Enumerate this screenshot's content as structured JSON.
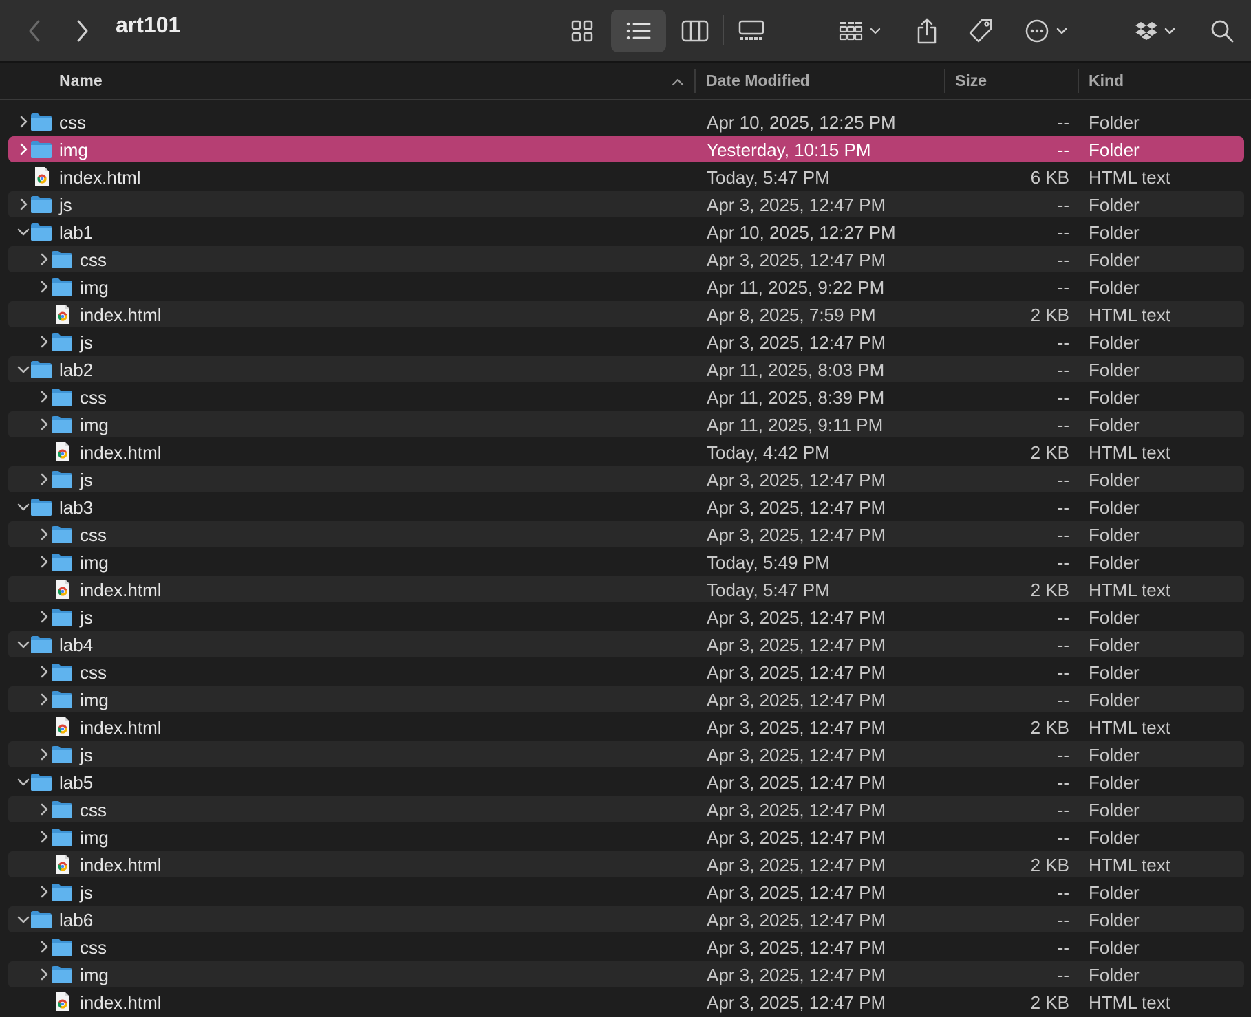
{
  "window": {
    "title": "art101"
  },
  "toolbar": {
    "back": "back-icon",
    "forward": "forward-icon",
    "views": [
      "icon-view-icon",
      "list-view-icon",
      "column-view-icon",
      "gallery-view-icon"
    ],
    "group": "group-icon",
    "share": "share-icon",
    "tag": "tag-icon",
    "more": "more-icon",
    "dropbox": "dropbox-icon",
    "search": "search-icon"
  },
  "columns": {
    "name": "Name",
    "date": "Date Modified",
    "size": "Size",
    "kind": "Kind"
  },
  "colors": {
    "selection": "#b63f73",
    "folder": "#5fb3ee"
  },
  "rows": [
    {
      "name": "css",
      "date": "Apr 10, 2025, 12:25 PM",
      "size": "--",
      "kind": "Folder",
      "type": "folder",
      "level": 0,
      "disclosure": "collapsed"
    },
    {
      "name": "img",
      "date": "Yesterday, 10:15 PM",
      "size": "--",
      "kind": "Folder",
      "type": "folder",
      "level": 0,
      "disclosure": "collapsed",
      "selected": true
    },
    {
      "name": "index.html",
      "date": "Today, 5:47 PM",
      "size": "6 KB",
      "kind": "HTML text",
      "type": "html",
      "level": 0,
      "disclosure": "none"
    },
    {
      "name": "js",
      "date": "Apr 3, 2025, 12:47 PM",
      "size": "--",
      "kind": "Folder",
      "type": "folder",
      "level": 0,
      "disclosure": "collapsed"
    },
    {
      "name": "lab1",
      "date": "Apr 10, 2025, 12:27 PM",
      "size": "--",
      "kind": "Folder",
      "type": "folder",
      "level": 0,
      "disclosure": "expanded"
    },
    {
      "name": "css",
      "date": "Apr 3, 2025, 12:47 PM",
      "size": "--",
      "kind": "Folder",
      "type": "folder",
      "level": 1,
      "disclosure": "collapsed"
    },
    {
      "name": "img",
      "date": "Apr 11, 2025, 9:22 PM",
      "size": "--",
      "kind": "Folder",
      "type": "folder",
      "level": 1,
      "disclosure": "collapsed"
    },
    {
      "name": "index.html",
      "date": "Apr 8, 2025, 7:59 PM",
      "size": "2 KB",
      "kind": "HTML text",
      "type": "html",
      "level": 1,
      "disclosure": "none"
    },
    {
      "name": "js",
      "date": "Apr 3, 2025, 12:47 PM",
      "size": "--",
      "kind": "Folder",
      "type": "folder",
      "level": 1,
      "disclosure": "collapsed"
    },
    {
      "name": "lab2",
      "date": "Apr 11, 2025, 8:03 PM",
      "size": "--",
      "kind": "Folder",
      "type": "folder",
      "level": 0,
      "disclosure": "expanded"
    },
    {
      "name": "css",
      "date": "Apr 11, 2025, 8:39 PM",
      "size": "--",
      "kind": "Folder",
      "type": "folder",
      "level": 1,
      "disclosure": "collapsed"
    },
    {
      "name": "img",
      "date": "Apr 11, 2025, 9:11 PM",
      "size": "--",
      "kind": "Folder",
      "type": "folder",
      "level": 1,
      "disclosure": "collapsed"
    },
    {
      "name": "index.html",
      "date": "Today, 4:42 PM",
      "size": "2 KB",
      "kind": "HTML text",
      "type": "html",
      "level": 1,
      "disclosure": "none"
    },
    {
      "name": "js",
      "date": "Apr 3, 2025, 12:47 PM",
      "size": "--",
      "kind": "Folder",
      "type": "folder",
      "level": 1,
      "disclosure": "collapsed"
    },
    {
      "name": "lab3",
      "date": "Apr 3, 2025, 12:47 PM",
      "size": "--",
      "kind": "Folder",
      "type": "folder",
      "level": 0,
      "disclosure": "expanded"
    },
    {
      "name": "css",
      "date": "Apr 3, 2025, 12:47 PM",
      "size": "--",
      "kind": "Folder",
      "type": "folder",
      "level": 1,
      "disclosure": "collapsed"
    },
    {
      "name": "img",
      "date": "Today, 5:49 PM",
      "size": "--",
      "kind": "Folder",
      "type": "folder",
      "level": 1,
      "disclosure": "collapsed"
    },
    {
      "name": "index.html",
      "date": "Today, 5:47 PM",
      "size": "2 KB",
      "kind": "HTML text",
      "type": "html",
      "level": 1,
      "disclosure": "none"
    },
    {
      "name": "js",
      "date": "Apr 3, 2025, 12:47 PM",
      "size": "--",
      "kind": "Folder",
      "type": "folder",
      "level": 1,
      "disclosure": "collapsed"
    },
    {
      "name": "lab4",
      "date": "Apr 3, 2025, 12:47 PM",
      "size": "--",
      "kind": "Folder",
      "type": "folder",
      "level": 0,
      "disclosure": "expanded"
    },
    {
      "name": "css",
      "date": "Apr 3, 2025, 12:47 PM",
      "size": "--",
      "kind": "Folder",
      "type": "folder",
      "level": 1,
      "disclosure": "collapsed"
    },
    {
      "name": "img",
      "date": "Apr 3, 2025, 12:47 PM",
      "size": "--",
      "kind": "Folder",
      "type": "folder",
      "level": 1,
      "disclosure": "collapsed"
    },
    {
      "name": "index.html",
      "date": "Apr 3, 2025, 12:47 PM",
      "size": "2 KB",
      "kind": "HTML text",
      "type": "html",
      "level": 1,
      "disclosure": "none"
    },
    {
      "name": "js",
      "date": "Apr 3, 2025, 12:47 PM",
      "size": "--",
      "kind": "Folder",
      "type": "folder",
      "level": 1,
      "disclosure": "collapsed"
    },
    {
      "name": "lab5",
      "date": "Apr 3, 2025, 12:47 PM",
      "size": "--",
      "kind": "Folder",
      "type": "folder",
      "level": 0,
      "disclosure": "expanded"
    },
    {
      "name": "css",
      "date": "Apr 3, 2025, 12:47 PM",
      "size": "--",
      "kind": "Folder",
      "type": "folder",
      "level": 1,
      "disclosure": "collapsed"
    },
    {
      "name": "img",
      "date": "Apr 3, 2025, 12:47 PM",
      "size": "--",
      "kind": "Folder",
      "type": "folder",
      "level": 1,
      "disclosure": "collapsed"
    },
    {
      "name": "index.html",
      "date": "Apr 3, 2025, 12:47 PM",
      "size": "2 KB",
      "kind": "HTML text",
      "type": "html",
      "level": 1,
      "disclosure": "none"
    },
    {
      "name": "js",
      "date": "Apr 3, 2025, 12:47 PM",
      "size": "--",
      "kind": "Folder",
      "type": "folder",
      "level": 1,
      "disclosure": "collapsed"
    },
    {
      "name": "lab6",
      "date": "Apr 3, 2025, 12:47 PM",
      "size": "--",
      "kind": "Folder",
      "type": "folder",
      "level": 0,
      "disclosure": "expanded"
    },
    {
      "name": "css",
      "date": "Apr 3, 2025, 12:47 PM",
      "size": "--",
      "kind": "Folder",
      "type": "folder",
      "level": 1,
      "disclosure": "collapsed"
    },
    {
      "name": "img",
      "date": "Apr 3, 2025, 12:47 PM",
      "size": "--",
      "kind": "Folder",
      "type": "folder",
      "level": 1,
      "disclosure": "collapsed"
    },
    {
      "name": "index.html",
      "date": "Apr 3, 2025, 12:47 PM",
      "size": "2 KB",
      "kind": "HTML text",
      "type": "html",
      "level": 1,
      "disclosure": "none"
    }
  ]
}
